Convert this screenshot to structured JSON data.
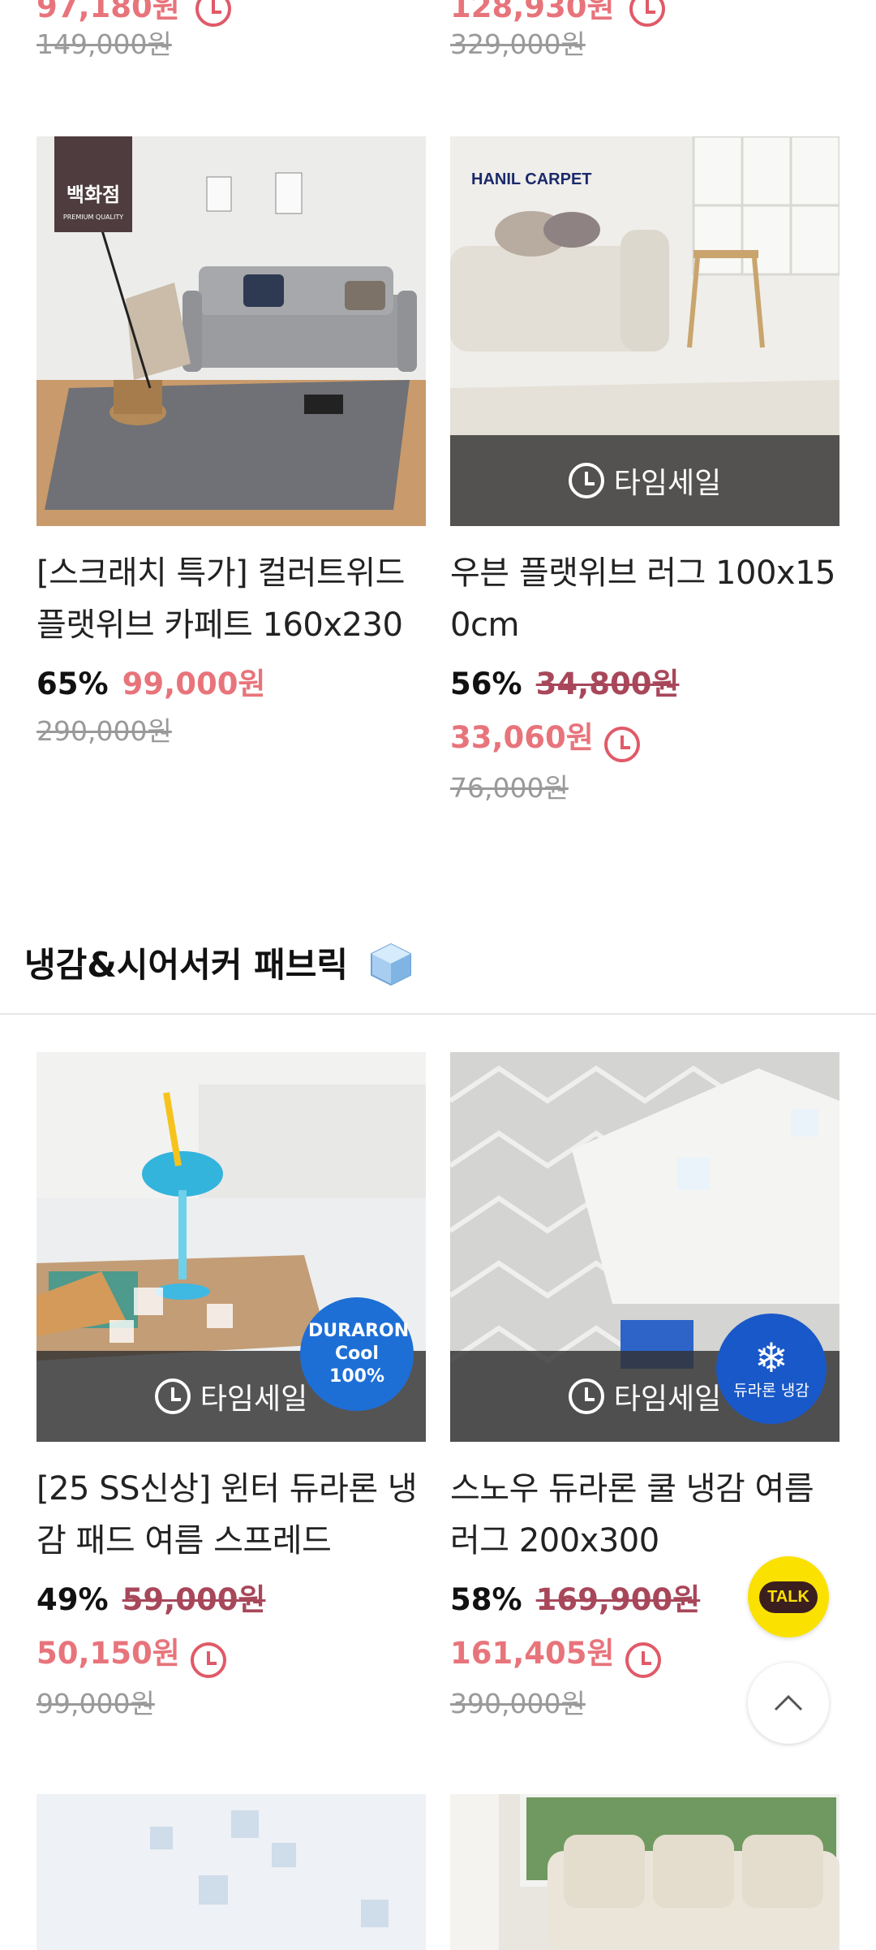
{
  "top_partial": {
    "left_price": "97,180원",
    "left_original": "149,000원",
    "right_price": "128,930원",
    "right_original": "329,000원"
  },
  "products_row1": [
    {
      "badge": "백화점",
      "badge_sub": "PREMIUM QUALITY",
      "title": "[스크래치 특가] 컬러트위드 플랫위브 카페트 160x230",
      "discount": "65%",
      "price": "99,000원",
      "original": "290,000원"
    },
    {
      "brand_logo": "HANIL CARPET",
      "timesale": "타임세일",
      "title": "우븐 플랫위브 러그 100x150cm",
      "discount": "56%",
      "list_price": "34,800원",
      "price": "33,060원",
      "original": "76,000원"
    }
  ],
  "section": {
    "title": "냉감&시어서커 패브릭",
    "icon": "ice-cube-icon"
  },
  "products_row2": [
    {
      "timesale": "타임세일",
      "image_badge": "DURARON Cool 100%",
      "title": "[25 SS신상] 윈터 듀라론 냉감 패드 여름 스프레드",
      "discount": "49%",
      "list_price": "59,000원",
      "price": "50,150원",
      "original": "99,000원"
    },
    {
      "timesale": "타임세일",
      "image_badge": "듀라론 냉감",
      "title": "스노우 듀라론 쿨 냉감 여름 러그 200x300",
      "discount": "58%",
      "list_price": "169,900원",
      "price": "161,405원",
      "original": "390,000원"
    }
  ],
  "floating": {
    "talk_label": "TALK",
    "scroll_top": "chevron-up-icon"
  },
  "colors": {
    "sale_red": "#e8747b",
    "strike_red": "#a8475a",
    "kakao_yellow": "#fae100"
  }
}
